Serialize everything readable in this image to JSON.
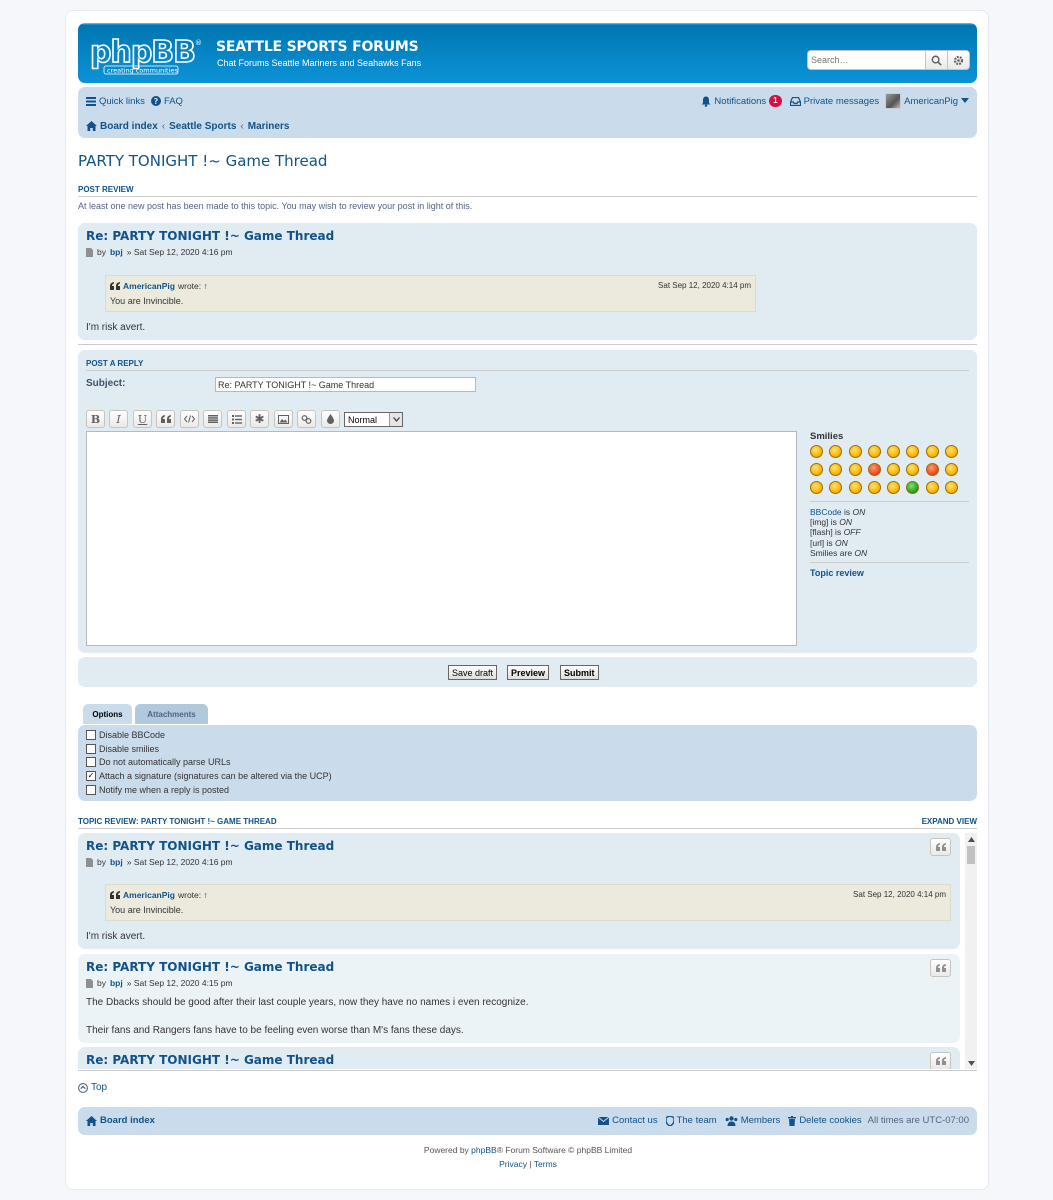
{
  "header": {
    "logo_text": "phpBB",
    "logo_tagline": "creating communities",
    "site_title": "SEATTLE SPORTS FORUMS",
    "site_desc": "Chat Forums Seattle Mariners and Seahawks Fans",
    "search_placeholder": "Search…"
  },
  "navbar": {
    "quick_links": "Quick links",
    "faq": "FAQ",
    "notifications": "Notifications",
    "notifications_count": "1",
    "private_messages": "Private messages",
    "username": "AmericanPig",
    "breadcrumbs": [
      "Board index",
      "Seattle Sports",
      "Mariners"
    ]
  },
  "page_title": "PARTY TONIGHT !~ Game Thread",
  "post_review": {
    "heading": "POST REVIEW",
    "notice": "At least one new post has been made to this topic. You may wish to review your post in light of this.",
    "post": {
      "title": "Re: PARTY TONIGHT !~ Game Thread",
      "by": "by",
      "author": "bpj",
      "date": "» Sat Sep 12, 2020 4:16 pm",
      "quote_author": "AmericanPig",
      "quote_wrote": "wrote: ↑",
      "quote_date": "Sat Sep 12, 2020 4:14 pm",
      "quote_text": "You are Invincible.",
      "body": "I'm risk avert."
    }
  },
  "reply": {
    "heading": "POST A REPLY",
    "subject_label": "Subject:",
    "subject_value": "Re: PARTY TONIGHT !~ Game Thread",
    "toolbar": {
      "bold": "B",
      "italic": "I",
      "underline": "U",
      "font_size": "Normal"
    },
    "smilies_heading": "Smilies",
    "bbcode_status": [
      {
        "label": "BBCode",
        "mid": " is ",
        "state": "ON"
      },
      {
        "label": "[img]",
        "mid": " is ",
        "state": "ON"
      },
      {
        "label": "[flash]",
        "mid": " is ",
        "state": "OFF"
      },
      {
        "label": "[url]",
        "mid": " is ",
        "state": "ON"
      },
      {
        "label": "Smilies",
        "mid": " are ",
        "state": "ON"
      }
    ],
    "topic_review_link": "Topic review",
    "buttons": {
      "save_draft": "Save draft",
      "preview": "Preview",
      "submit": "Submit"
    }
  },
  "options": {
    "tabs": [
      "Options",
      "Attachments"
    ],
    "items": [
      {
        "label": "Disable BBCode",
        "checked": false
      },
      {
        "label": "Disable smilies",
        "checked": false
      },
      {
        "label": "Do not automatically parse URLs",
        "checked": false
      },
      {
        "label": "Attach a signature (signatures can be altered via the UCP)",
        "checked": true
      },
      {
        "label": "Notify me when a reply is posted",
        "checked": false
      }
    ]
  },
  "topic_review": {
    "heading": "TOPIC REVIEW: PARTY TONIGHT !~ GAME THREAD",
    "expand": "EXPAND VIEW",
    "posts": [
      {
        "title": "Re: PARTY TONIGHT !~ Game Thread",
        "by": "by",
        "author": "bpj",
        "date": "» Sat Sep 12, 2020 4:16 pm",
        "quote_author": "AmericanPig",
        "quote_wrote": "wrote: ↑",
        "quote_date": "Sat Sep 12, 2020 4:14 pm",
        "quote_text": "You are Invincible.",
        "body": "I'm risk avert."
      },
      {
        "title": "Re: PARTY TONIGHT !~ Game Thread",
        "by": "by",
        "author": "bpj",
        "date": "» Sat Sep 12, 2020 4:15 pm",
        "body1": "The Dbacks should be good after their last couple years, now they have no names i even recognize.",
        "body2": "Their fans and Rangers fans have to be feeling even worse than M's fans these days."
      },
      {
        "title": "Re: PARTY TONIGHT !~ Game Thread"
      }
    ]
  },
  "top_link": "Top",
  "footer": {
    "board_index": "Board index",
    "contact": "Contact us",
    "team": "The team",
    "members": "Members",
    "delete_cookies": "Delete cookies",
    "timezone": "All times are UTC-07:00",
    "powered_pre": "Powered by ",
    "powered_link": "phpBB",
    "powered_post": "® Forum Software © phpBB Limited",
    "privacy": "Privacy",
    "sep": "|",
    "terms": "Terms"
  },
  "colors": {
    "link": "#105289",
    "header": "#12a3eb",
    "badge": "#d31141"
  }
}
